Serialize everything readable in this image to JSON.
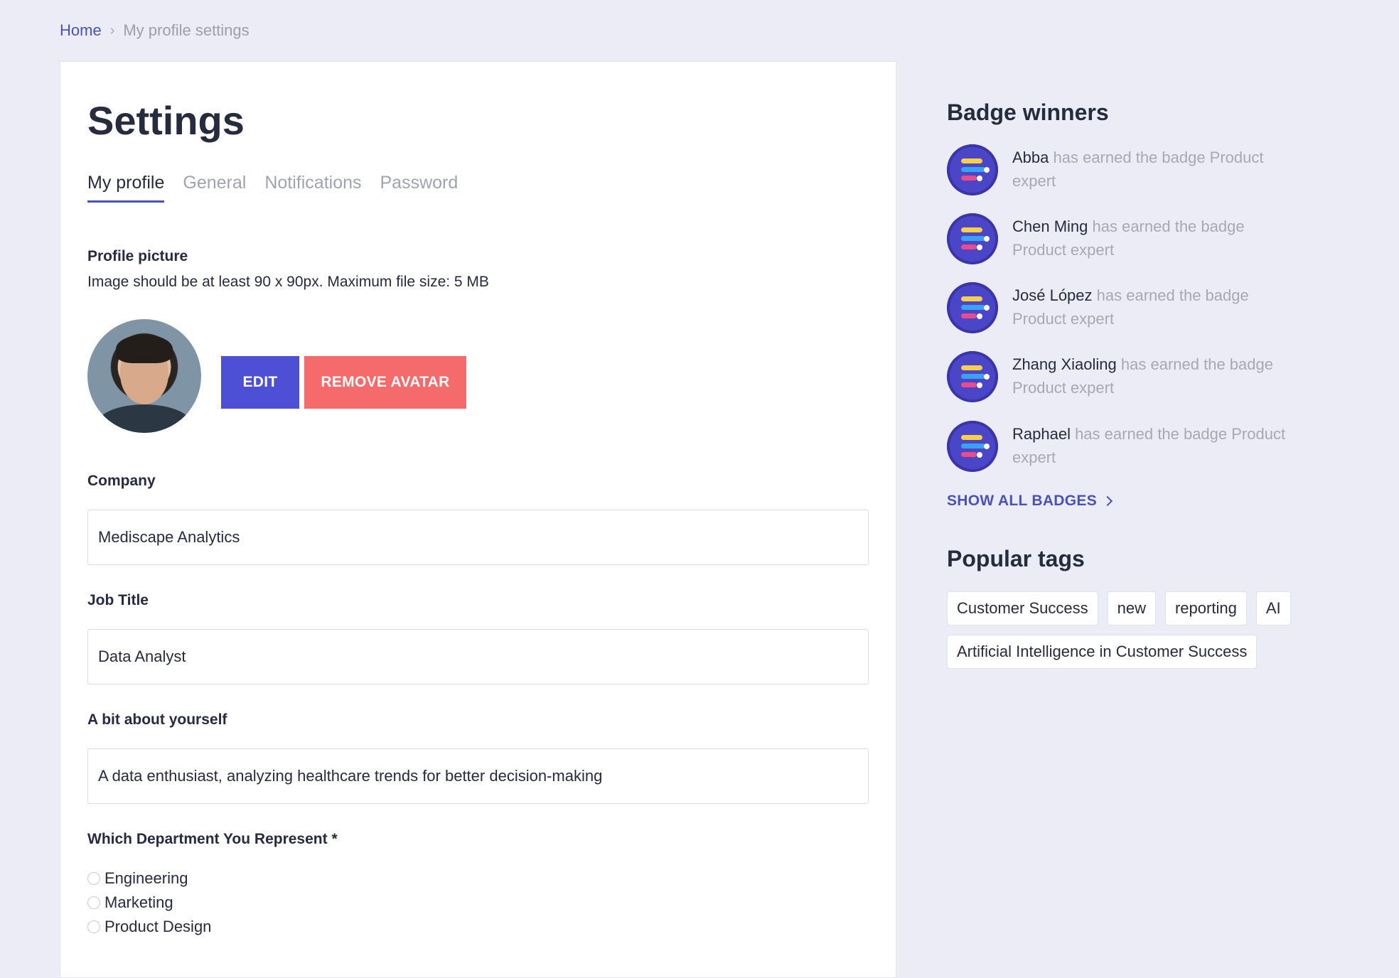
{
  "breadcrumb": {
    "home": "Home",
    "current": "My profile settings"
  },
  "settings": {
    "title": "Settings",
    "tabs": [
      {
        "label": "My profile"
      },
      {
        "label": "General"
      },
      {
        "label": "Notifications"
      },
      {
        "label": "Password"
      }
    ],
    "profile_picture": {
      "label": "Profile picture",
      "hint": "Image should be at least 90 x 90px. Maximum file size: 5 MB",
      "edit_label": "EDIT",
      "remove_label": "REMOVE AVATAR"
    },
    "company": {
      "label": "Company",
      "value": "Mediscape Analytics"
    },
    "job_title": {
      "label": "Job Title",
      "value": "Data Analyst"
    },
    "about": {
      "label": "A bit about yourself",
      "value": "A data enthusiast, analyzing healthcare trends for better decision-making"
    },
    "department": {
      "label": "Which Department You Represent *",
      "options": [
        "Engineering",
        "Marketing",
        "Product Design"
      ]
    }
  },
  "sidebar": {
    "badge_heading": "Badge winners",
    "winners": [
      {
        "name": "Abba",
        "text_line1": " has earned the badge Product",
        "text_line2": "expert"
      },
      {
        "name": "Chen Ming",
        "text_line1": " has earned the badge",
        "text_line2": "Product expert"
      },
      {
        "name": "José López",
        "text_line1": " has earned the badge",
        "text_line2": "Product expert"
      },
      {
        "name": "Zhang Xiaoling",
        "text_line1": " has earned the badge",
        "text_line2": "Product expert"
      },
      {
        "name": "Raphael",
        "text_line1": " has earned the badge Product",
        "text_line2": "expert"
      }
    ],
    "show_all_label": "SHOW ALL BADGES",
    "tags_heading": "Popular tags",
    "tags": [
      "Customer Success",
      "new",
      "reporting",
      "AI",
      "Artificial Intelligence in Customer Success"
    ]
  },
  "colors": {
    "accent": "#4a51b8",
    "edit_button": "#4d4fd4",
    "remove_button": "#f56b6b",
    "background": "#ebecf5"
  },
  "icons": {
    "breadcrumb_separator": "chevron-right-icon",
    "show_all": "chevron-right-icon",
    "badge": "product-expert-badge-icon"
  }
}
